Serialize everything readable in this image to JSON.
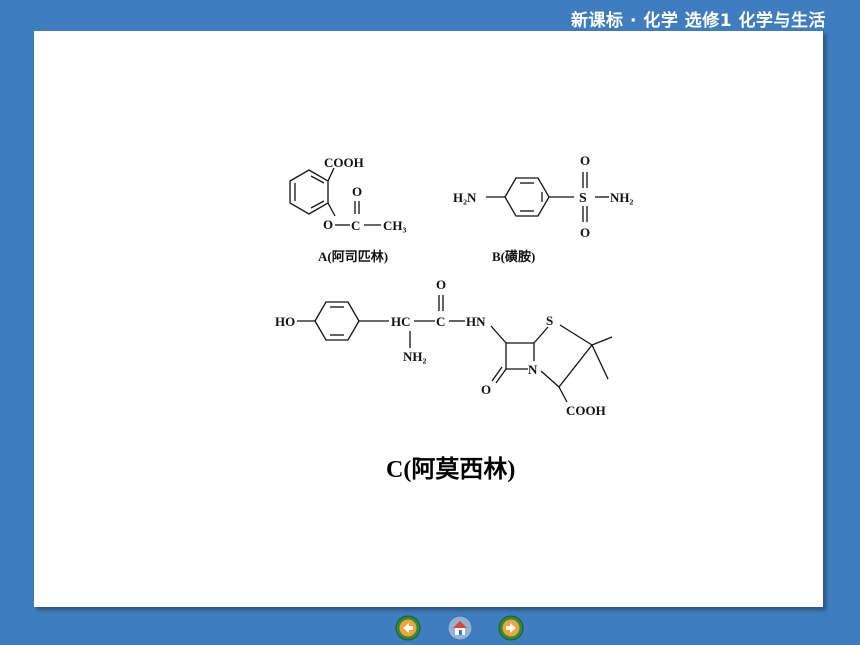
{
  "header": {
    "title": "新课标 · 化学  选修1  化学与生活"
  },
  "structures": {
    "a": {
      "caption": "A(阿司匹林)",
      "cooh": "COOH",
      "o_ring": "O",
      "c": "C",
      "ch3": "CH₃",
      "o_top": "O"
    },
    "b": {
      "caption": "B(磺胺)",
      "h2n": "H₂N",
      "s": "S",
      "nh2": "NH₂",
      "o_top": "O",
      "o_bottom": "O"
    },
    "c": {
      "caption": "C(阿莫西林)",
      "ho": "HO",
      "hc": "HC",
      "c": "C",
      "hn": "HN",
      "o_top": "O",
      "nh2": "NH₂",
      "s": "S",
      "n": "N",
      "o_bottom": "O",
      "cooh": "COOH"
    }
  },
  "nav": {
    "prev_icon": "left-arrow-icon",
    "home_icon": "home-icon",
    "next_icon": "right-arrow-icon"
  }
}
